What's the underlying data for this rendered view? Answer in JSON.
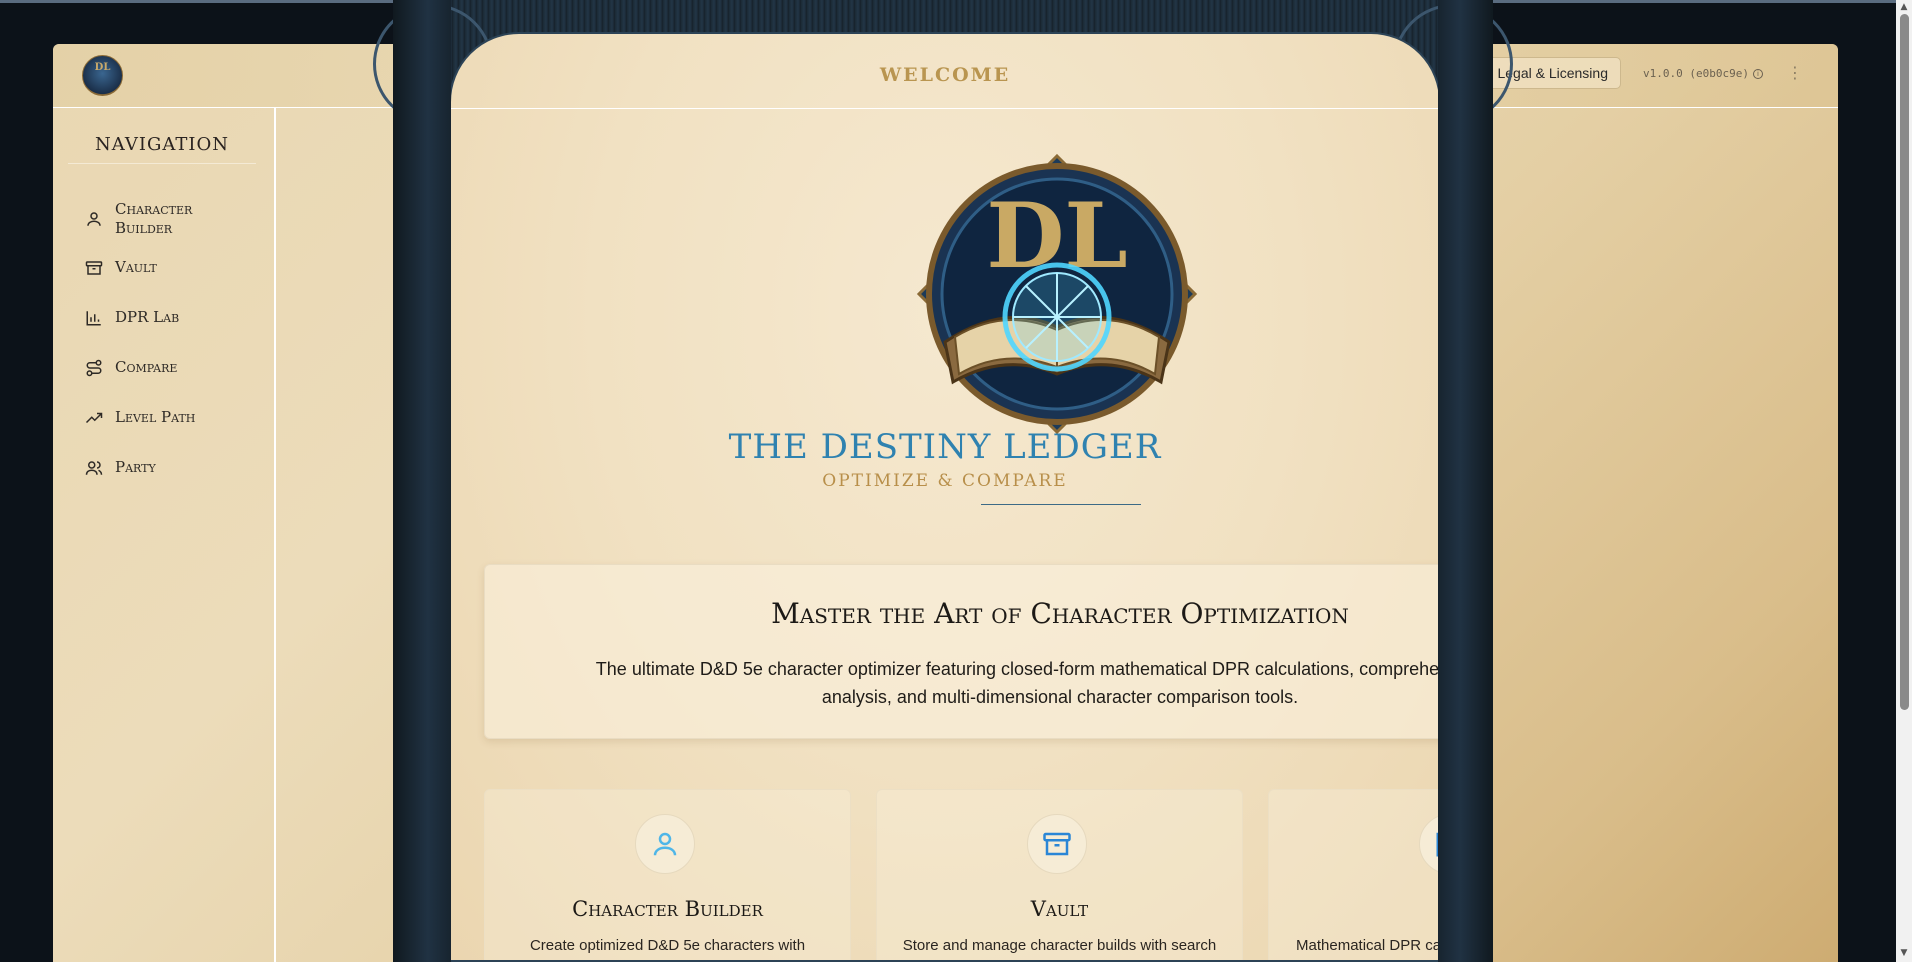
{
  "header": {
    "logo_text": "DL",
    "legal_button": "Legal & Licensing",
    "version": "v1.0.0 (e0b0c9e)",
    "info_symbol": "i",
    "menu_symbol": "⋮"
  },
  "sidebar": {
    "title": "NAVIGATION",
    "items": [
      {
        "label": "Character Builder",
        "icon": "user-icon"
      },
      {
        "label": "Vault",
        "icon": "archive-icon"
      },
      {
        "label": "DPR Lab",
        "icon": "bar-chart-icon"
      },
      {
        "label": "Compare",
        "icon": "route-icon"
      },
      {
        "label": "Level Path",
        "icon": "trending-up-icon"
      },
      {
        "label": "Party",
        "icon": "users-icon"
      }
    ]
  },
  "main": {
    "welcome": "WELCOME",
    "brand_title": "THE DESTINY LEDGER",
    "brand_subtitle": "OPTIMIZE & COMPARE",
    "emblem_letters": "DL",
    "intro_title": "Master the Art of Character Optimization",
    "intro_text": "The ultimate D&D 5e character optimizer featuring closed-form mathematical DPR calculations, comprehensive build analysis, and multi-dimensional character comparison tools.",
    "features": [
      {
        "title": "Character Builder",
        "desc": "Create optimized D&D 5e characters with multiclass progression and equipment",
        "icon": "user-icon"
      },
      {
        "title": "Vault",
        "desc": "Store and manage character builds with search and export tools",
        "icon": "archive-icon"
      },
      {
        "title": "",
        "desc": "Mathematical DPR calculations with probability",
        "icon": "bar-chart-icon"
      }
    ]
  },
  "colors": {
    "accent_blue": "#2f82b0",
    "gold": "#b88f4a",
    "frame": "#17242f",
    "parchment": "#f1e1c2"
  }
}
